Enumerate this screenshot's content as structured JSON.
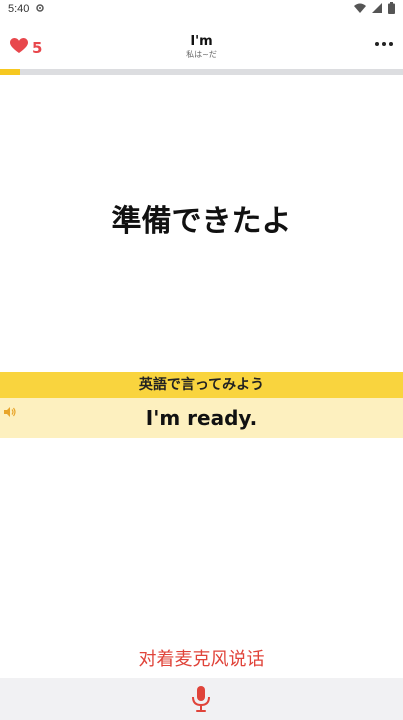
{
  "status": {
    "time": "5:40"
  },
  "header": {
    "lives": "5",
    "title": "I'm",
    "subtitle": "私は~だ"
  },
  "progress": {
    "fraction": 0.05
  },
  "prompt": {
    "text": "準備できたよ"
  },
  "instruction": {
    "text": "英語で言ってみよう"
  },
  "answer": {
    "text": "I'm ready."
  },
  "speak_hint": {
    "text": "对着麦克风说话"
  },
  "icons": {
    "lives": "heart-icon",
    "more": "more-horizontal-icon",
    "speaker": "speaker-icon",
    "mic": "microphone-icon",
    "wifi": "wifi-icon",
    "signal": "signal-icon",
    "battery": "battery-icon",
    "settings": "gear-icon"
  },
  "colors": {
    "accent": "#f6c821",
    "heart": "#e8474c",
    "hint": "#e0443a",
    "banner": "#f9d43e",
    "answer_bg": "#fdf0bf",
    "mic": "#e0443a"
  }
}
